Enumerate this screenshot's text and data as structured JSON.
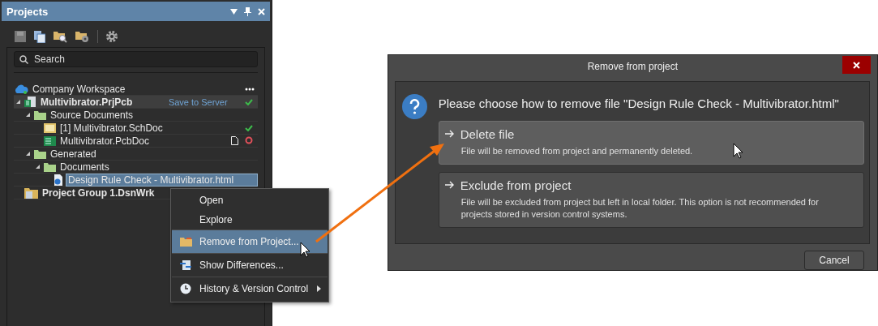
{
  "panel": {
    "title": "Projects",
    "search": {
      "placeholder": "Search"
    },
    "workspace": {
      "label": "Company Workspace"
    },
    "tree": [
      {
        "label": "Multivibrator.PrjPcb",
        "kind": "project",
        "expanded": true,
        "selected": false,
        "action": "Save to Server",
        "synced": true,
        "children": [
          {
            "label": "Source Documents",
            "kind": "folder",
            "expanded": true,
            "selected": false,
            "children": [
              {
                "label": "[1] Multivibrator.SchDoc",
                "kind": "schematic",
                "selected": false,
                "synced": true,
                "modified": false
              },
              {
                "label": "Multivibrator.PcbDoc",
                "kind": "pcb",
                "selected": false,
                "synced": false,
                "modified": true
              }
            ]
          },
          {
            "label": "Generated",
            "kind": "folder",
            "expanded": true,
            "selected": false,
            "children": [
              {
                "label": "Documents",
                "kind": "folder",
                "expanded": true,
                "selected": false,
                "children": [
                  {
                    "label": "Design Rule Check - Multivibrator.html",
                    "kind": "html",
                    "selected": true
                  }
                ]
              }
            ]
          }
        ]
      },
      {
        "label": "Project Group 1.DsnWrk",
        "kind": "group",
        "selected": false
      }
    ]
  },
  "context_menu": {
    "items": [
      {
        "label": "Open",
        "kind": "plain",
        "submenu": false,
        "selected": false,
        "separator": false
      },
      {
        "label": "Explore",
        "kind": "plain",
        "submenu": false,
        "selected": false,
        "separator": false
      },
      {
        "label": "Remove from Project...",
        "kind": "remove",
        "submenu": false,
        "selected": true,
        "separator": true
      },
      {
        "label": "Show Differences...",
        "kind": "compare",
        "submenu": false,
        "selected": false,
        "separator": true
      },
      {
        "label": "History & Version Control",
        "kind": "history",
        "submenu": true,
        "selected": false,
        "separator": true
      }
    ]
  },
  "dialog": {
    "title": "Remove from project",
    "message": "Please choose how to remove file \"Design Rule Check - Multivibrator.html\"",
    "options": [
      {
        "title": "Delete file",
        "description": "File will be removed from project and permanently deleted.",
        "selected": true
      },
      {
        "title": "Exclude from project",
        "description": "File will be excluded from project but left in local folder. This option is not recommended for projects stored in version control systems.",
        "selected": false
      }
    ],
    "buttons": [
      "Cancel"
    ]
  }
}
